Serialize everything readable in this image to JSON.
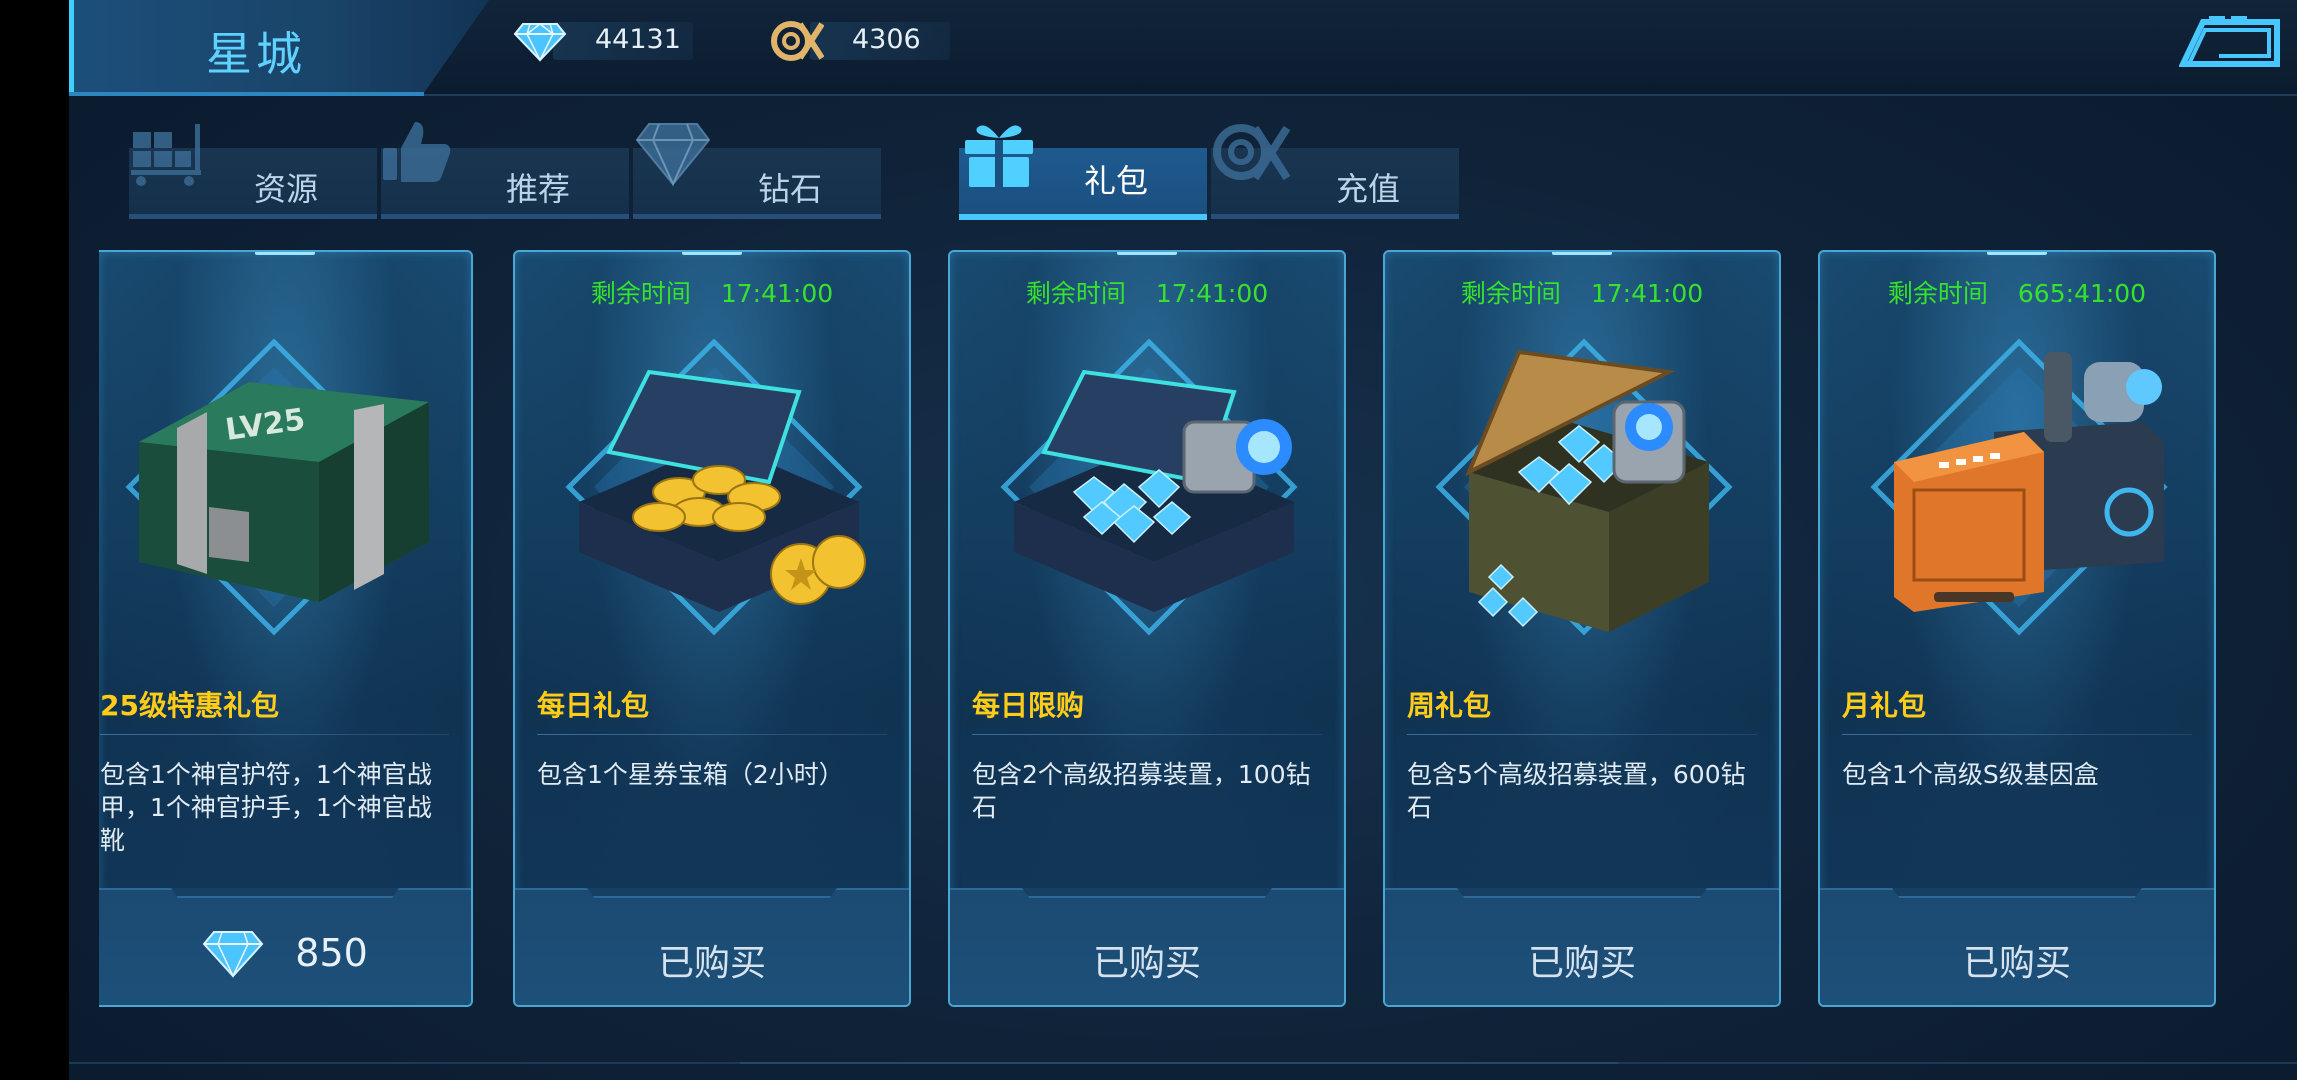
{
  "header": {
    "title": "星城",
    "gems": "44131",
    "coins": "4306"
  },
  "tabs": [
    {
      "label": "资源",
      "icon": "crates-icon",
      "active": false
    },
    {
      "label": "推荐",
      "icon": "thumbs-up-icon",
      "active": false
    },
    {
      "label": "钻石",
      "icon": "diamond-icon",
      "active": false
    },
    {
      "label": "礼包",
      "icon": "gift-icon",
      "active": true
    },
    {
      "label": "充值",
      "icon": "coin-icon",
      "active": false
    }
  ],
  "timer_label": "剩余时间",
  "cards": [
    {
      "name": "25级特惠礼包",
      "timer": "",
      "desc": "包含1个神官护符，1个神官战甲，1个神官护手，1个神官战靴",
      "price": "850",
      "status": "",
      "art": "lv25-chest-icon",
      "chest_text": "LV25"
    },
    {
      "name": "每日礼包",
      "timer": "17:41:00",
      "desc": "包含1个星券宝箱（2小时）",
      "price": "",
      "status": "已购买",
      "art": "coin-chest-icon"
    },
    {
      "name": "每日限购",
      "timer": "17:41:00",
      "desc": "包含2个高级招募装置，100钻石",
      "price": "",
      "status": "已购买",
      "art": "diamond-chest-icon"
    },
    {
      "name": "周礼包",
      "timer": "17:41:00",
      "desc": "包含5个高级招募装置，600钻石",
      "price": "",
      "status": "已购买",
      "art": "crystal-crate-icon"
    },
    {
      "name": "月礼包",
      "timer": "665:41:00",
      "desc": "包含1个高级S级基因盒",
      "price": "",
      "status": "已购买",
      "art": "gene-box-icon"
    }
  ],
  "colors": {
    "accent": "#48c7ff",
    "timer": "#37e22c",
    "card_title": "#ffcc18"
  }
}
